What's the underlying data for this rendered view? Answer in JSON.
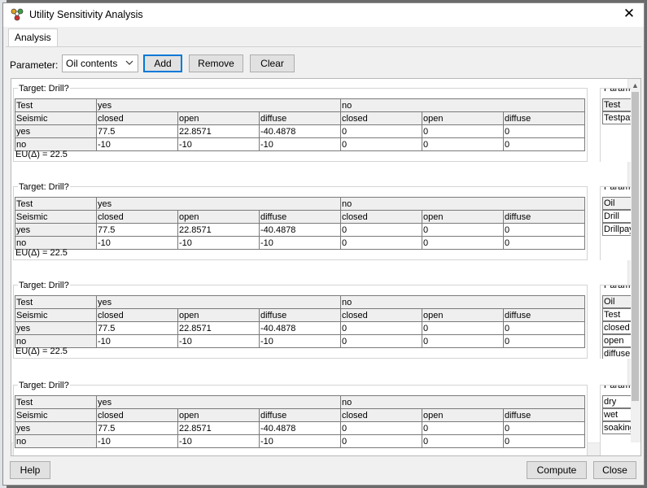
{
  "window": {
    "title": "Utility Sensitivity Analysis"
  },
  "tabs": [
    {
      "label": "Analysis"
    }
  ],
  "toolbar": {
    "parameter_label": "Parameter:",
    "parameter_value": "Oil contents",
    "add_label": "Add",
    "remove_label": "Remove",
    "clear_label": "Clear"
  },
  "panels": [
    {
      "title": "Target: Drill?",
      "rows": [
        [
          "Test",
          "yes",
          "",
          "",
          "no",
          "",
          ""
        ],
        [
          "Seismic",
          "closed",
          "open",
          "diffuse",
          "closed",
          "open",
          "diffuse"
        ],
        [
          "yes",
          "77.5",
          "22.8571",
          "-40.4878",
          "0",
          "0",
          "0"
        ],
        [
          "no",
          "-10",
          "-10",
          "-10",
          "0",
          "0",
          "0"
        ]
      ],
      "eu": "EU(Δ) = 22.5",
      "side": {
        "title": "Parameters",
        "items": [
          "Test",
          "Testpay"
        ]
      }
    },
    {
      "title": "Target: Drill?",
      "rows": [
        [
          "Test",
          "yes",
          "",
          "",
          "no",
          "",
          ""
        ],
        [
          "Seismic",
          "closed",
          "open",
          "diffuse",
          "closed",
          "open",
          "diffuse"
        ],
        [
          "yes",
          "77.5",
          "22.8571",
          "-40.4878",
          "0",
          "0",
          "0"
        ],
        [
          "no",
          "-10",
          "-10",
          "-10",
          "0",
          "0",
          "0"
        ]
      ],
      "eu": "EU(Δ) = 22.5",
      "side": {
        "title": "Parameters",
        "items": [
          "Oil",
          "Drill",
          "Drillpay"
        ]
      }
    },
    {
      "title": "Target: Drill?",
      "rows": [
        [
          "Test",
          "yes",
          "",
          "",
          "no",
          "",
          ""
        ],
        [
          "Seismic",
          "closed",
          "open",
          "diffuse",
          "closed",
          "open",
          "diffuse"
        ],
        [
          "yes",
          "77.5",
          "22.8571",
          "-40.4878",
          "0",
          "0",
          "0"
        ],
        [
          "no",
          "-10",
          "-10",
          "-10",
          "0",
          "0",
          "0"
        ]
      ],
      "eu": "EU(Δ) = 22.5",
      "side": {
        "title": "Parameters",
        "items": [
          "Oil",
          "Test",
          "closed",
          "open",
          "diffuse"
        ]
      }
    },
    {
      "title": "Target: Drill?",
      "rows": [
        [
          "Test",
          "yes",
          "",
          "",
          "no",
          "",
          ""
        ],
        [
          "Seismic",
          "closed",
          "open",
          "diffuse",
          "closed",
          "open",
          "diffuse"
        ],
        [
          "yes",
          "77.5",
          "22.8571",
          "-40.4878",
          "0",
          "0",
          "0"
        ],
        [
          "no",
          "-10",
          "-10",
          "-10",
          "0",
          "0",
          "0"
        ]
      ],
      "eu": "",
      "side": {
        "title": "Parameters",
        "items": [
          "dry",
          "wet",
          "soaking"
        ]
      }
    }
  ],
  "footer": {
    "help_label": "Help",
    "compute_label": "Compute",
    "close_label": "Close"
  }
}
